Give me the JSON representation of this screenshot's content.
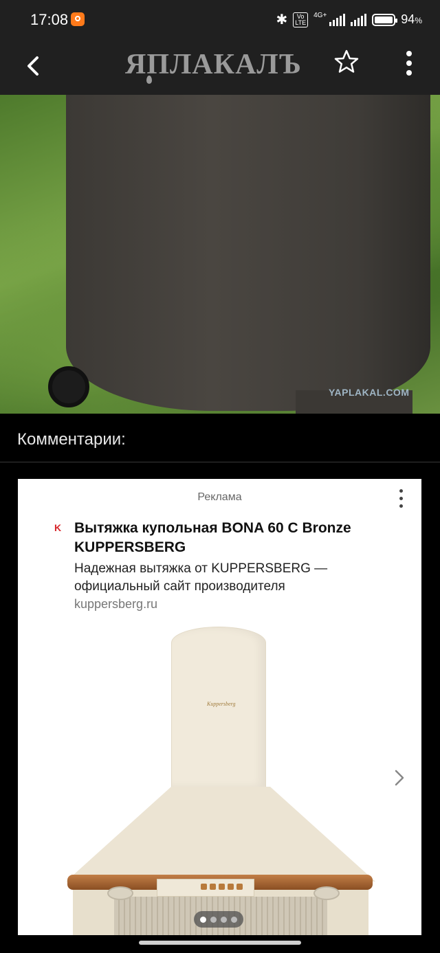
{
  "status_bar": {
    "time": "17:08",
    "network": "4G+",
    "battery": "94",
    "battery_unit": "%",
    "volte_top": "Vo",
    "volte_bottom": "LTE"
  },
  "header": {
    "logo_text": "ЯПЛАКАЛЪ",
    "back_icon": "chevron-left-icon",
    "favorite_icon": "star-icon",
    "menu_icon": "more-vertical-icon"
  },
  "photo": {
    "watermark": "YAPLAKAL.COM"
  },
  "comments": {
    "heading": "Комментарии:"
  },
  "ad": {
    "label": "Реклама",
    "favicon_letter": "K",
    "title": "Вытяжка купольная BONA 60 C Bronze KUPPERSBERG",
    "description": "Надежная вытяжка от KUPPERSBERG — официальный сайт производителя",
    "domain": "kuppersberg.ru",
    "product_brand": "Kuppersberg",
    "carousel": {
      "total": 4,
      "active_index": 0
    }
  },
  "colors": {
    "bar_background": "#202020",
    "page_background": "#000000",
    "ad_background": "#ffffff",
    "favicon": "#d7262b"
  }
}
